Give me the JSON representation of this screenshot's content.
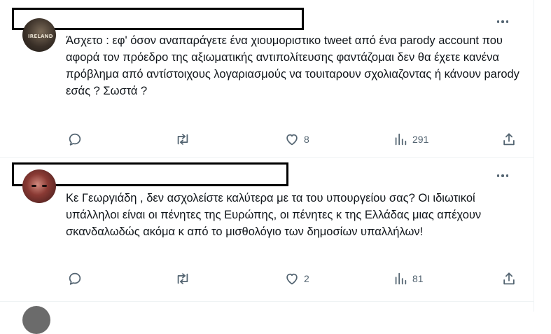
{
  "tweets": [
    {
      "text": "Άσχετο : εφ' όσον αναπαράγετε ένα χιουμοριστικο tweet από ένα parody account που αφορά τον πρόεδρο της αξιωματικής αντιπολίτευσης φαντάζομαι δεν θα έχετε κανένα πρόβλημα από αντίστοιχους λογαριασμούς να τουιταρουν σχολιαζοντας ή κάνουν parody εσάς ? Σωστά ?",
      "avatar_text": "IRELAND",
      "replies": "",
      "retweets": "",
      "likes": "8",
      "views": "291"
    },
    {
      "text": "Κε Γεωργιάδη , δεν ασχολείστε καλύτερα με τα του υπουργείου σας? Οι ιδιωτικοί υπάλληλοι είναι οι πένητες της Ευρώπης, οι πένητες κ της Ελλάδας μιας απέχουν σκανδαλωδώς ακόμα κ από το μισθολόγιο των δημοσίων υπαλλήλων!",
      "replies": "",
      "retweets": "",
      "likes": "2",
      "views": "81"
    }
  ],
  "icons": {
    "reply": "reply-icon",
    "retweet": "retweet-icon",
    "like": "heart-icon",
    "views": "views-icon",
    "share": "share-icon",
    "more": "more-icon"
  },
  "colors": {
    "text": "#0f1419",
    "secondary": "#536471",
    "divider": "#eff3f4"
  }
}
